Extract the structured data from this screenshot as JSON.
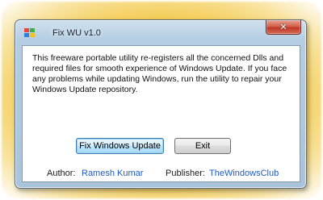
{
  "window": {
    "title": "Fix WU v1.0",
    "close_symbol": "✕",
    "icon": "windows-logo-icon"
  },
  "content": {
    "description": "This freeware portable utility re-registers all the concerned Dlls and required files for smooth experience of Windows Update. If you face any problems while updating Windows, run the utility to repair your Windows Update repository."
  },
  "buttons": {
    "fix": "Fix Windows Update",
    "exit": "Exit"
  },
  "credits": {
    "author_label": "Author:",
    "author_name": "Ramesh Kumar",
    "publisher_label": "Publisher:",
    "publisher_name": "TheWindowsClub"
  },
  "colors": {
    "link": "#1e5bc6",
    "glow": "#f4c94a",
    "close": "#c0392b"
  }
}
